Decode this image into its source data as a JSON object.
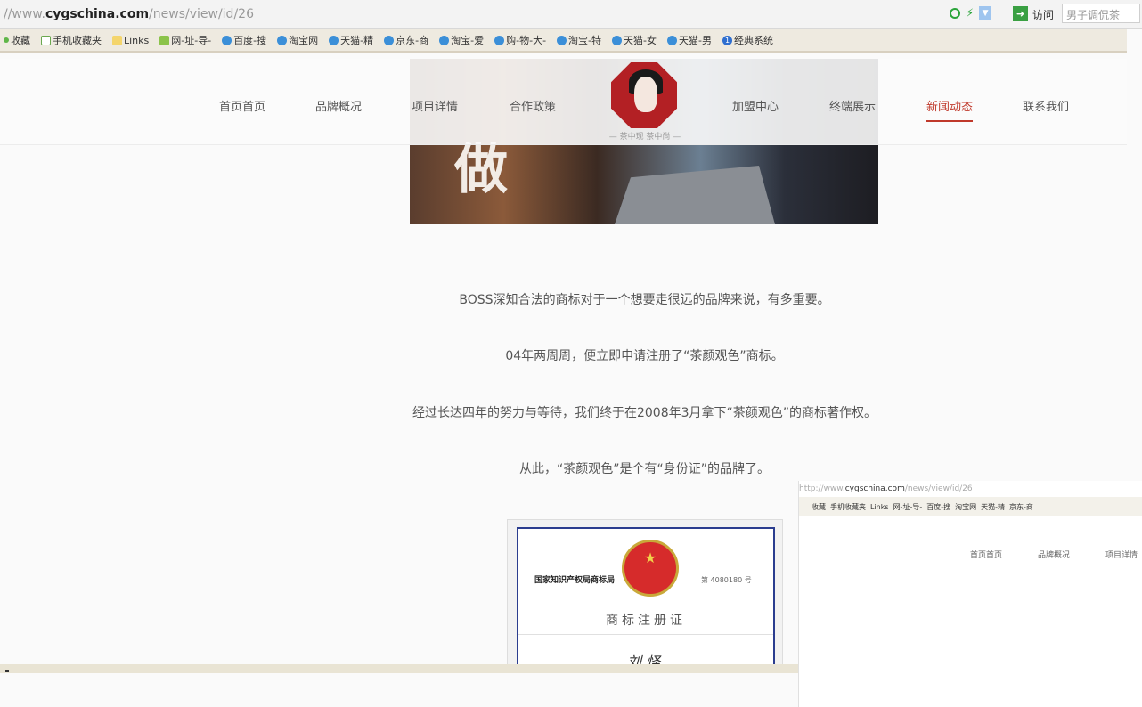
{
  "browser": {
    "url_scheme": "//www.",
    "url_host": "cygschina.com",
    "url_path": "/news/view/id/26",
    "go_label": "访问",
    "search_placeholder": "男子调侃茶"
  },
  "bookmarks": [
    {
      "label": "收藏",
      "icon": "star"
    },
    {
      "label": "手机收藏夹",
      "icon": "page"
    },
    {
      "label": "Links",
      "icon": "folder"
    },
    {
      "label": "网-址-导-",
      "icon": "house"
    },
    {
      "label": "百度-搜",
      "icon": "globe"
    },
    {
      "label": "淘宝网",
      "icon": "globe"
    },
    {
      "label": "天猫-精",
      "icon": "globe"
    },
    {
      "label": "京东-商",
      "icon": "globe"
    },
    {
      "label": "淘宝-爱",
      "icon": "globe"
    },
    {
      "label": "购-物-大-",
      "icon": "globe"
    },
    {
      "label": "淘宝-特",
      "icon": "globe"
    },
    {
      "label": "天猫-女",
      "icon": "globe"
    },
    {
      "label": "天猫-男",
      "icon": "globe"
    },
    {
      "label": "经典系统",
      "icon": "num"
    }
  ],
  "nav": {
    "items": [
      "首页首页",
      "品牌概况",
      "项目详情",
      "合作政策",
      "加盟中心",
      "终端展示",
      "新闻动态",
      "联系我们"
    ],
    "active_index": 6,
    "logo_tagline": "— 茶中现 茶中尚 —"
  },
  "banner": {
    "char": "做"
  },
  "article": {
    "paragraphs": [
      "BOSS深知合法的商标对于一个想要走很远的品牌来说，有多重要。",
      "04年两周周，便立即申请注册了“茶颜观色”商标。",
      "经过长达四年的努力与等待，我们终于在2008年3月拿下“茶颜观色”的商标著作权。",
      "从此，“茶颜观色”是个有“身份证”的品牌了。"
    ]
  },
  "certificate": {
    "left_text": "国家知识产权局商标局",
    "right_text": "第 4080180 号",
    "title": "商标注册证",
    "signature": "刘 怪"
  },
  "inset": {
    "url_scheme": "http://www.",
    "url_host": "cygschina.com",
    "url_path": "/news/view/id/26",
    "bookmarks": [
      "收藏",
      "手机收藏夹",
      "Links",
      "网-址-导-",
      "百度-搜",
      "淘宝网",
      "天猫-精",
      "京东-商"
    ],
    "nav_items": [
      "首页首页",
      "品牌概况",
      "项目详情"
    ]
  },
  "colors": {
    "accent": "#c0392b",
    "logo_red": "#b32024",
    "certificate_border": "#2b3d8f"
  }
}
